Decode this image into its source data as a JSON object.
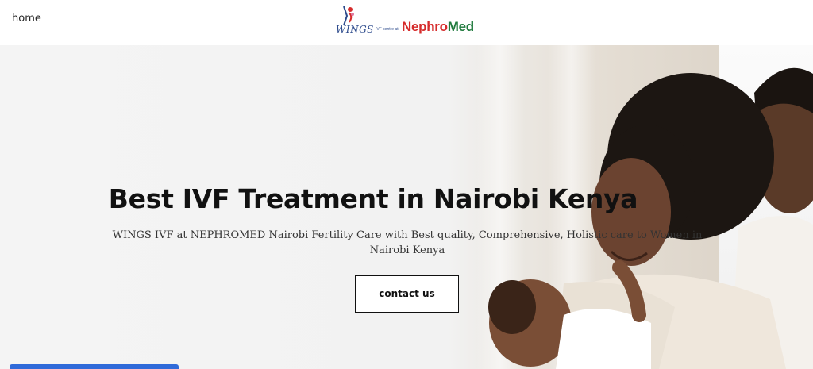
{
  "nav": {
    "home_label": "home"
  },
  "logo": {
    "wings_text": "WINGS",
    "ivf_text": "IVF centre at",
    "nephro_text": "Nephro",
    "med_text": "Med"
  },
  "hero": {
    "title": "Best IVF Treatment in Nairobi Kenya",
    "subtitle": "WINGS IVF at NEPHROMED Nairobi Fertility Care with Best quality, Comprehensive, Holistic care to Women in Nairobi Kenya",
    "cta_label": "contact us"
  },
  "colors": {
    "accent_blue": "#2f6ad9",
    "nephro_red": "#d62c2c",
    "med_green": "#1f7a3d",
    "wings_blue": "#2c4a8c"
  }
}
